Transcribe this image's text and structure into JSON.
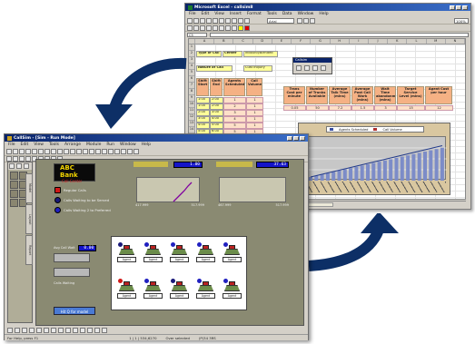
{
  "excel": {
    "title": "Microsoft Excel - callsim8",
    "menu": [
      "File",
      "Edit",
      "View",
      "Insert",
      "Format",
      "Tools",
      "Data",
      "Window",
      "Help"
    ],
    "font_box": "Arial",
    "zoom": "100%",
    "name_box": "C5",
    "row_numbers": [
      "1",
      "2",
      "3",
      "4",
      "5",
      "6",
      "7",
      "8",
      "9",
      "10",
      "11",
      "12",
      "13",
      "14",
      "15",
      "16",
      "17",
      "18",
      "19",
      "20",
      "21",
      "22",
      "23",
      "24",
      "25"
    ],
    "col_letters": [
      "A",
      "B",
      "C",
      "D",
      "E",
      "F",
      "G",
      "H",
      "I",
      "J",
      "K",
      "L",
      "M",
      "N"
    ],
    "cells": {
      "type_of_call": "Type of Call",
      "center": "Center",
      "center_value": "Inbound/Blended",
      "nature_of_call": "Nature of Call",
      "nature_value": "Cust Inquiry",
      "hdr_shift_start": "Shift Start",
      "hdr_shift_end": "Shift End",
      "hdr_agents": "Agents Scheduled",
      "hdr_call_volume": "Call Volume",
      "hdr_trans_cost": "Trans Cost per minute",
      "hdr_trunks": "Number of Trunks Available",
      "hdr_talk": "Average Talk Time (mins)",
      "hdr_post_call": "Average Post Call Work (mins)",
      "hdr_wait": "Wait Time abandonmt (mins)",
      "hdr_service": "Target Service Level (mins)",
      "hdr_agent_cost": "Agent Cost per hour"
    },
    "shift_rows": [
      [
        "1:00",
        "2:00",
        "1",
        "1"
      ],
      [
        "1:00",
        "2:00",
        "2",
        "1"
      ],
      [
        "2:00",
        "3:00",
        "3",
        "1"
      ],
      [
        "3:00",
        "4:00",
        "4",
        "1"
      ],
      [
        "4:00",
        "5:00",
        "5",
        "1"
      ],
      [
        "5:00",
        "6:00",
        "5",
        "1"
      ],
      [
        "6:00",
        "7:00",
        "6",
        "1"
      ]
    ],
    "param_values": [
      "0.05",
      "50",
      "7.2",
      "1.5",
      "3",
      "15",
      "12"
    ],
    "popup_title": "Callsim",
    "chart_legend": [
      "Agents Scheduled",
      "Call Volume"
    ]
  },
  "callsim": {
    "title": "CallSim - [Sim - Run Mode]",
    "menu": [
      "File",
      "Edit",
      "View",
      "Tools",
      "Arrange",
      "Module",
      "Run",
      "Window",
      "Help"
    ],
    "bank_name": "ABC Bank",
    "bank_sub": "Call Center",
    "legend": [
      {
        "label": "Regular Calls",
        "color": "#d01818"
      },
      {
        "label": "Calls Waiting to be Served",
        "color": "#1a1a7a"
      },
      {
        "label": "Calls Waiting 2 to Preferred",
        "color": "#2020c0"
      }
    ],
    "readout_left": "1.00",
    "readout_right": "37.63",
    "axis_left": [
      "417.999",
      "517.999"
    ],
    "axis_right": [
      "467.999",
      "517.999"
    ],
    "small_readout": "0.00",
    "small_label": "Avg Call Wait",
    "queue_label": "Calls Waiting",
    "agent_tag": "Agent",
    "run_label": "Hit Q for model",
    "side_tabs": [
      "Model",
      "Layout",
      "Report"
    ],
    "status_left": "For Help, press F1",
    "status_mid": "1 | 1 | 534,6270",
    "status_right": "Over selected",
    "status_far": "(P)34 3RS"
  }
}
